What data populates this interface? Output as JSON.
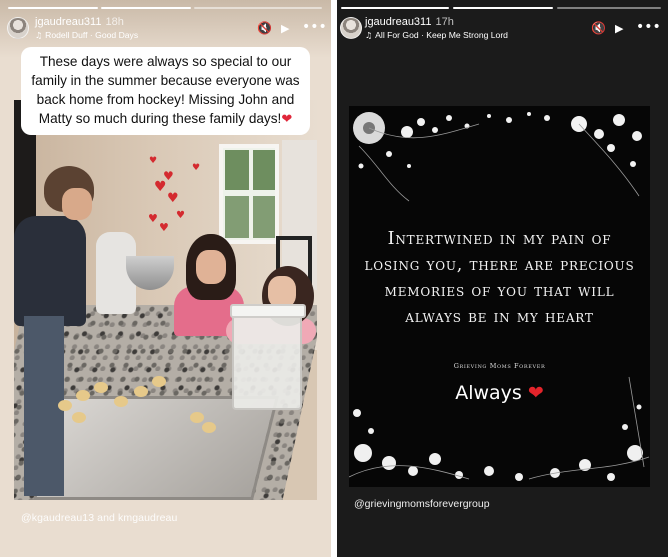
{
  "left_story": {
    "username": "jgaudreau311",
    "time": "18h",
    "music": "Rodell Duff · Good Days",
    "caption": "These days were always so special to our family in the summer because everyone was back home from hockey! Missing John and Matty so much during these family days!",
    "caption_emoji": "❤",
    "mention": "@kgaudreau13 and kmgaudreau"
  },
  "right_story": {
    "username": "jgaudreau311",
    "time": "17h",
    "music": "All For God · Keep Me Strong Lord",
    "quote": "Intertwined in my pain of losing you, there are precious memories of you that will always be in my heart",
    "brand": "Grieving Moms Forever",
    "always": "Always",
    "always_emoji": "❤",
    "mention": "@grievingmomsforevergroup"
  },
  "icons": {
    "mute": "mute-icon",
    "play": "play-icon",
    "more": "more-icon",
    "music": "music-note-icon"
  },
  "colors": {
    "heart": "#e0263a",
    "left_bg": "#e9ddd0",
    "right_bg": "#1b1b1b"
  }
}
